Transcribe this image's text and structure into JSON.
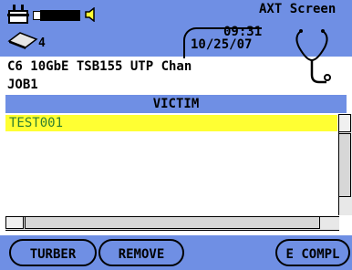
{
  "header": {
    "title": "AXT Screen",
    "card_count": "4",
    "time": "09:31",
    "date": "10/25/07",
    "cable_type": "C6 10GbE TSB155 UTP Chan",
    "job": "JOB1",
    "battery_level": 0.92
  },
  "table": {
    "column_header": "VICTIM",
    "rows": [
      "TEST001"
    ],
    "selected_index": 0
  },
  "buttons": {
    "btn1": "TURBER",
    "btn2": "REMOVE",
    "btn3": "E COMPL"
  },
  "colors": {
    "accent_blue": "#6f8fe4",
    "selection_yellow": "#ffff33",
    "selection_text": "#2f7f2f"
  }
}
